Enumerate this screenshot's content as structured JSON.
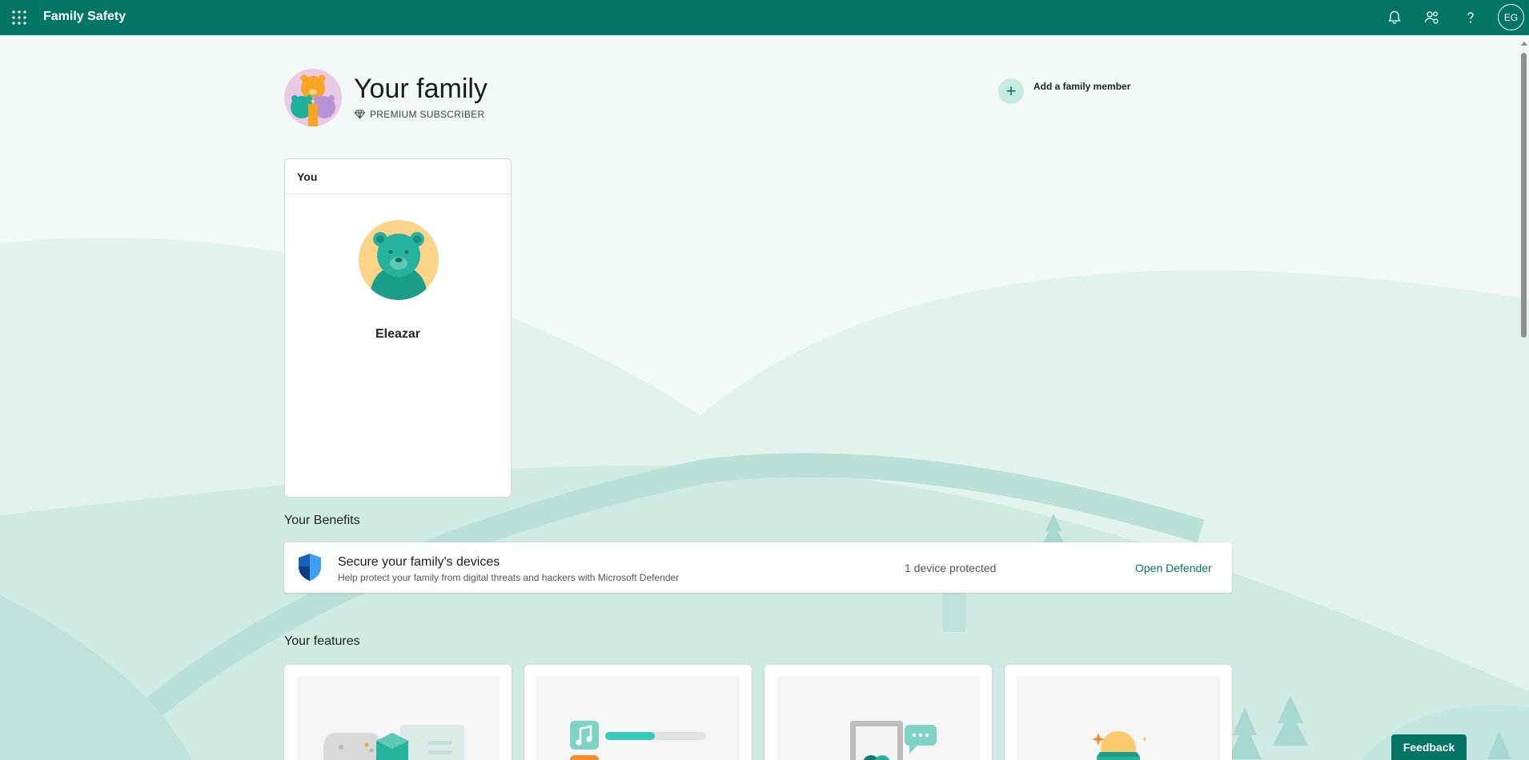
{
  "app": {
    "title": "Family Safety",
    "user_initials": "EG"
  },
  "colors": {
    "brand": "#037565",
    "accent_light": "#c7e9e3",
    "background": "#eef7f5"
  },
  "icons": {
    "waffle": "waffle-icon",
    "notifications": "bell-icon",
    "family": "people-settings-icon",
    "help": "help-icon"
  },
  "header": {
    "title": "Your family",
    "badge": "PREMIUM SUBSCRIBER",
    "add_member_label": "Add a family member"
  },
  "members": [
    {
      "group_label": "You",
      "name": "Eleazar"
    }
  ],
  "benefits": {
    "section_title": "Your Benefits",
    "items": [
      {
        "title": "Secure your family's devices",
        "subtitle": "Help protect your family from digital threats and hackers with Microsoft Defender",
        "status": "1 device protected",
        "action": "Open Defender"
      }
    ]
  },
  "features": {
    "section_title": "Your features",
    "count": 4
  },
  "feedback_label": "Feedback"
}
